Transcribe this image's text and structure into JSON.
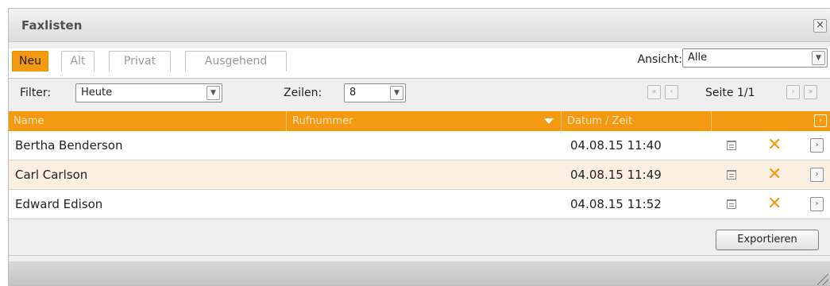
{
  "window": {
    "title": "Faxlisten",
    "close_glyph": "×"
  },
  "tabs": [
    {
      "label": "Neu",
      "active": true
    },
    {
      "label": "Alt",
      "active": false
    },
    {
      "label": "Privat",
      "active": false
    },
    {
      "label": "Ausgehend",
      "active": false
    }
  ],
  "view": {
    "label": "Ansicht:",
    "value": "Alle"
  },
  "filter": {
    "label": "Filter:",
    "value": "Heute"
  },
  "rows_per_page": {
    "label": "Zeilen:",
    "value": "8"
  },
  "pagination": {
    "first_glyph": "«",
    "prev_glyph": "‹",
    "next_glyph": "›",
    "last_glyph": "»",
    "page_text": "Seite 1/1"
  },
  "table": {
    "columns": [
      "Name",
      "Rufnummer",
      "Datum / Zeit"
    ],
    "sorted_column": "Rufnummer",
    "more_glyph": "›",
    "rows": [
      {
        "name": "Bertha Benderson",
        "number": "",
        "datetime": "04.08.15 11:40"
      },
      {
        "name": "Carl Carlson",
        "number": "",
        "datetime": "04.08.15 11:49"
      },
      {
        "name": "Edward Edison",
        "number": "",
        "datetime": "04.08.15 11:52"
      }
    ],
    "delete_glyph": "✕",
    "open_glyph": "›"
  },
  "actions": {
    "export_label": "Exportieren"
  },
  "colors": {
    "accent": "#f39a10",
    "row_alt": "#fbefe2",
    "header_text": "#fde6c3"
  },
  "icons": [
    "close-icon",
    "fax-icon",
    "delete-icon",
    "chevron-right-icon",
    "chevron-down-icon",
    "resize-grip-icon"
  ]
}
